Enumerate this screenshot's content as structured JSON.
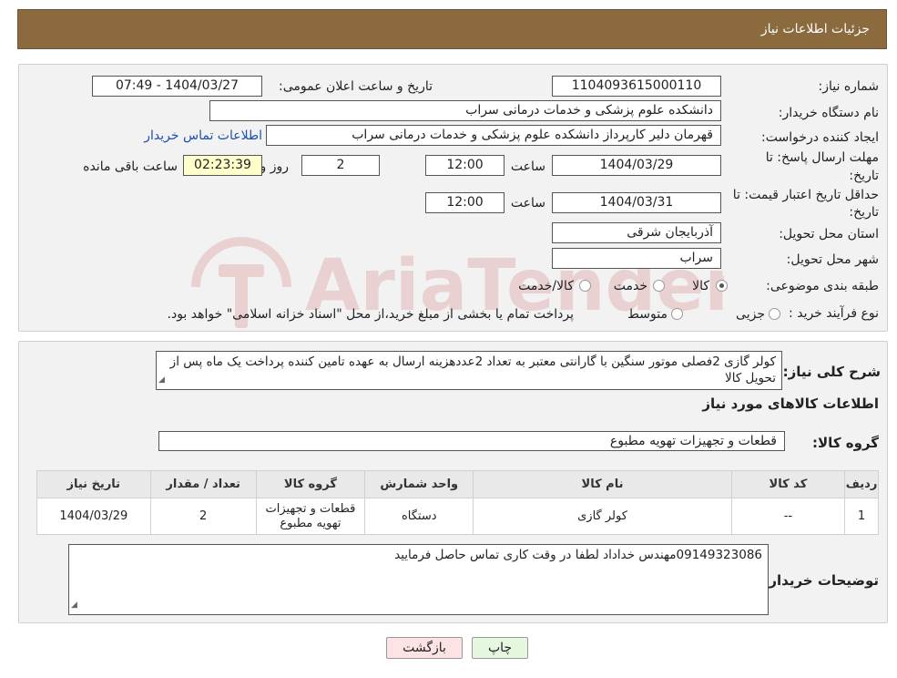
{
  "header": {
    "title": "جزئیات اطلاعات نیاز"
  },
  "form": {
    "need_number_label": "شماره نیاز:",
    "need_number": "1104093615000110",
    "announce_label": "تاریخ و ساعت اعلان عمومی:",
    "announce_value": "1404/03/27 - 07:49",
    "buyer_org_label": "نام دستگاه خریدار:",
    "buyer_org": "دانشکده علوم پزشکی و خدمات درمانی سراب",
    "requester_label": "ایجاد کننده درخواست:",
    "requester": "قهرمان دلیر کارپرداز دانشکده علوم پزشکی و خدمات درمانی سراب",
    "contact_link": "اطلاعات تماس خریدار",
    "deadline_label_1": "مهلت ارسال پاسخ: تا",
    "deadline_label_2": "تاریخ:",
    "deadline_date": "1404/03/29",
    "time_label": "ساعت",
    "deadline_time": "12:00",
    "days_value": "2",
    "days_label": "روز و",
    "remaining_time": "02:23:39",
    "remaining_label": "ساعت باقی مانده",
    "validity_label_1": "حداقل تاریخ اعتبار قیمت: تا",
    "validity_label_2": "تاریخ:",
    "validity_date": "1404/03/31",
    "validity_time_label": "ساعت",
    "validity_time": "12:00",
    "province_label": "استان محل تحویل:",
    "province": "آذربایجان شرقی",
    "city_label": "شهر محل تحویل:",
    "city": "سراب",
    "category_label": "طبقه بندی موضوعی:",
    "category_options": [
      "کالا",
      "خدمت",
      "کالا/خدمت"
    ],
    "category_selected": "کالا",
    "process_label": "نوع فرآیند خرید :",
    "process_options": [
      "جزیی",
      "متوسط"
    ],
    "process_note": "پرداخت تمام یا بخشی از مبلغ خرید،از محل \"اسناد خزانه اسلامی\" خواهد بود."
  },
  "details": {
    "summary_label": "شرح کلی نیاز:",
    "summary": "کولر گازی 2فصلی  موتور سنگین با گارانتی معتبر به تعداد 2عددهزینه ارسال به عهده تامین کننده پرداخت یک ماه پس از تحویل کالا",
    "goods_info_title": "اطلاعات کالاهای مورد نیاز",
    "goods_group_label": "گروه کالا:",
    "goods_group": "قطعات و تجهیزات تهویه مطبوع",
    "table": {
      "headers": [
        "ردیف",
        "کد کالا",
        "نام کالا",
        "واحد شمارش",
        "گروه کالا",
        "تعداد / مقدار",
        "تاریخ نیاز"
      ],
      "rows": [
        [
          "1",
          "--",
          "کولر گازی",
          "دستگاه",
          "قطعات و تجهیزات تهویه مطبوع",
          "2",
          "1404/03/29"
        ]
      ]
    },
    "buyer_notes_label": "توضیحات خریدار:",
    "buyer_notes": "09149323086مهندس خداداد لطفا در وقت کاری تماس حاصل فرمایید"
  },
  "buttons": {
    "print": "چاپ",
    "back": "بازگشت"
  },
  "watermark_text": "AriaTender.neT"
}
